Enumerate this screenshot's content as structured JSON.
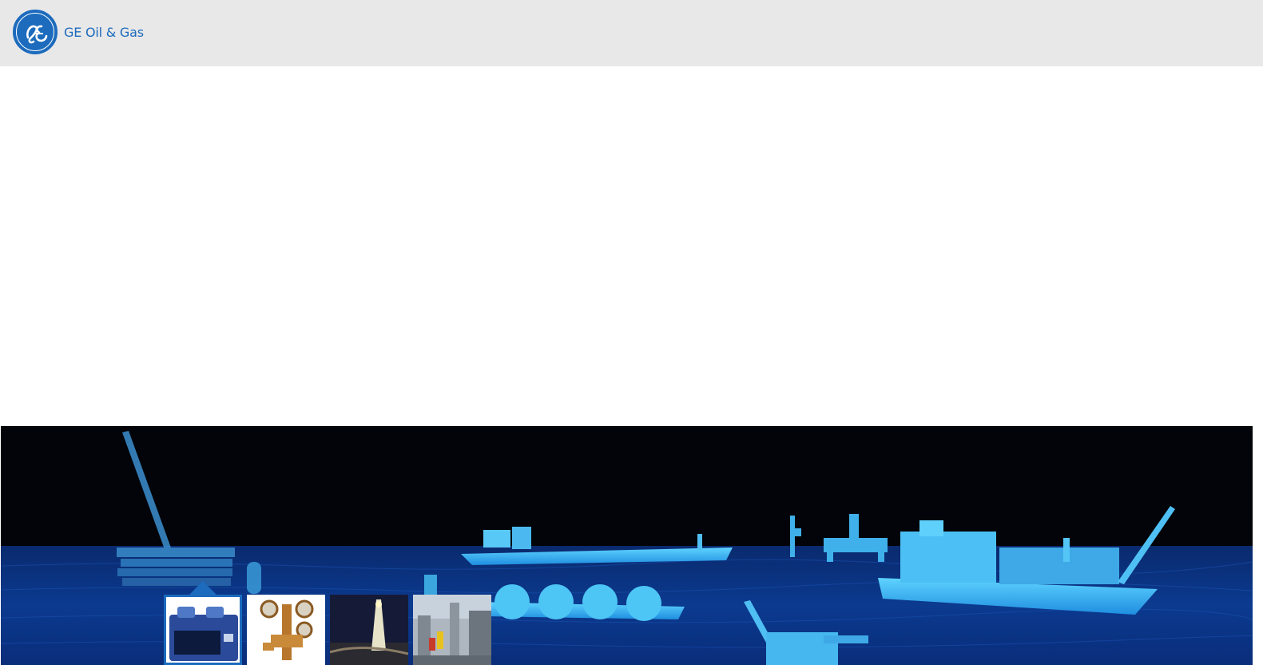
{
  "header": {
    "brand_name": "GE Oil & Gas",
    "logo_icon": "ge-monogram-icon",
    "background_color": "#e8e8e8",
    "brand_color": "#1c6bbd"
  },
  "hero": {
    "image": "offshore-fleet-hologram-illustration",
    "background_color": "#020409",
    "accent_color": "#2fb5ff"
  },
  "carousel": {
    "active_index": 0,
    "thumbnails": [
      {
        "image": "gas-analyzer-device-thumbnail"
      },
      {
        "image": "brass-pressure-regulator-thumbnail"
      },
      {
        "image": "drilling-rig-at-night-thumbnail"
      },
      {
        "image": "processing-plant-workers-thumbnail"
      }
    ]
  }
}
